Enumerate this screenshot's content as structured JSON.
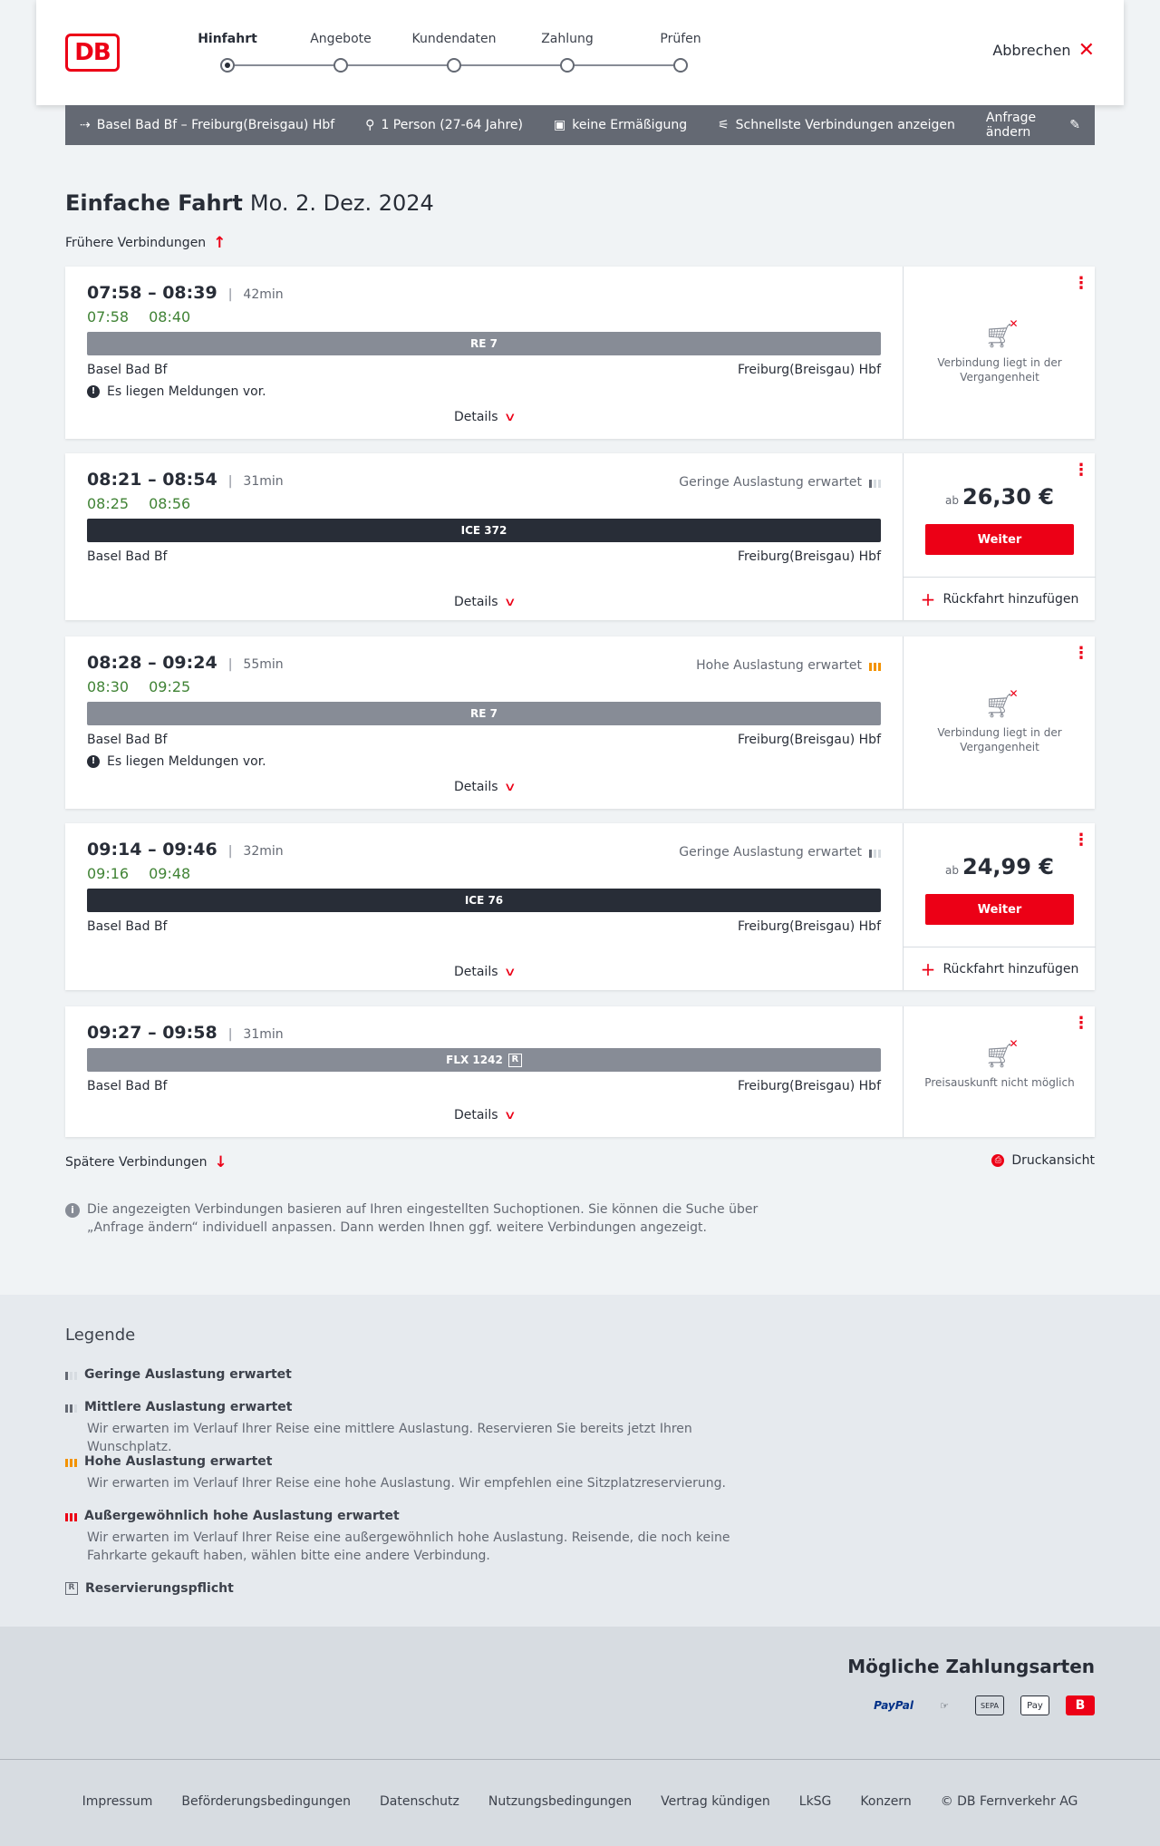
{
  "header": {
    "logo": "DB",
    "steps": [
      "Hinfahrt",
      "Angebote",
      "Kundendaten",
      "Zahlung",
      "Prüfen"
    ],
    "active_step": 0,
    "cancel_label": "Abbrechen"
  },
  "searchbar": {
    "route": "Basel Bad Bf – Freiburg(Breisgau) Hbf",
    "passengers": "1 Person (27-64 Jahre)",
    "discount": "keine Ermäßigung",
    "fastest": "Schnellste Verbindungen anzeigen",
    "edit": "Anfrage ändern"
  },
  "page": {
    "title": "Einfache Fahrt",
    "date": "Mo. 2. Dez. 2024",
    "earlier": "Frühere Verbindungen",
    "later": "Spätere Verbindungen",
    "print": "Druckansicht",
    "info": "Die angezeigten Verbindungen basieren auf Ihren eingestellten Suchoptionen. Sie können die Suche über „Anfrage ändern“ individuell anpassen. Dann werden Ihnen ggf. weitere Verbindungen angezeigt."
  },
  "connections": [
    {
      "times": "07:58 – 08:39",
      "duration": "42min",
      "rt_dep": "07:58",
      "rt_arr": "08:40",
      "train": "RE 7",
      "from": "Basel Bad Bf",
      "to": "Freiburg(Breisgau) Hbf",
      "message": "Es liegen Meldungen vor.",
      "details": "Details",
      "unavailable": "Verbindung liegt in der Vergangenheit"
    },
    {
      "times": "08:21 – 08:54",
      "duration": "31min",
      "rt_dep": "08:25",
      "rt_arr": "08:56",
      "occupancy": "Geringe Auslastung erwartet",
      "train": "ICE 372",
      "from": "Basel Bad Bf",
      "to": "Freiburg(Breisgau) Hbf",
      "details": "Details",
      "price_prefix": "ab",
      "price": "26,30 €",
      "button": "Weiter",
      "return": "Rückfahrt hinzufügen"
    },
    {
      "times": "08:28 – 09:24",
      "duration": "55min",
      "rt_dep": "08:30",
      "rt_arr": "09:25",
      "occupancy": "Hohe Auslastung erwartet",
      "train": "RE 7",
      "from": "Basel Bad Bf",
      "to": "Freiburg(Breisgau) Hbf",
      "message": "Es liegen Meldungen vor.",
      "details": "Details",
      "unavailable": "Verbindung liegt in der Vergangenheit"
    },
    {
      "times": "09:14 – 09:46",
      "duration": "32min",
      "rt_dep": "09:16",
      "rt_arr": "09:48",
      "occupancy": "Geringe Auslastung erwartet",
      "train": "ICE 76",
      "from": "Basel Bad Bf",
      "to": "Freiburg(Breisgau) Hbf",
      "details": "Details",
      "price_prefix": "ab",
      "price": "24,99 €",
      "button": "Weiter",
      "return": "Rückfahrt hinzufügen"
    },
    {
      "times": "09:27 – 09:58",
      "duration": "31min",
      "train": "FLX 1242",
      "reservation_badge": "R",
      "from": "Basel Bad Bf",
      "to": "Freiburg(Breisgau) Hbf",
      "details": "Details",
      "unavailable": "Preisauskunft nicht möglich"
    }
  ],
  "legend": {
    "title": "Legende",
    "items": [
      {
        "title": "Geringe Auslastung erwartet",
        "text": ""
      },
      {
        "title": "Mittlere Auslastung erwartet",
        "text": "Wir erwarten im Verlauf Ihrer Reise eine mittlere Auslastung. Reservieren Sie bereits jetzt Ihren Wunschplatz."
      },
      {
        "title": "Hohe Auslastung erwartet",
        "text": "Wir erwarten im Verlauf Ihrer Reise eine hohe Auslastung. Wir empfehlen eine Sitzplatzreservierung."
      },
      {
        "title": "Außergewöhnlich hohe Auslastung erwartet",
        "text": "Wir erwarten im Verlauf Ihrer Reise eine außergewöhnlich hohe Auslastung. Reisende, die noch keine Fahrkarte gekauft haben, wählen bitte eine andere Verbindung."
      },
      {
        "title": "Reservierungspflicht",
        "text": ""
      }
    ]
  },
  "payment": {
    "title": "Mögliche Zahlungsarten",
    "methods": [
      "PayPal",
      "Kreditkarte",
      "SEPA",
      "Apple Pay",
      "DB"
    ],
    "labels": {
      "paypal": "PayPal",
      "card": "☞",
      "sepa": "SEPA",
      "apple": " Pay",
      "db": "B"
    }
  },
  "footer": {
    "links": [
      "Impressum",
      "Beförderungsbedingungen",
      "Datenschutz",
      "Nutzungsbedingungen",
      "Vertrag kündigen",
      "LkSG",
      "Konzern",
      "© DB Fernverkehr AG"
    ]
  },
  "colors": {
    "brand": "#ec0016",
    "realtime": "#408335",
    "high_occupancy": "#f39200"
  }
}
